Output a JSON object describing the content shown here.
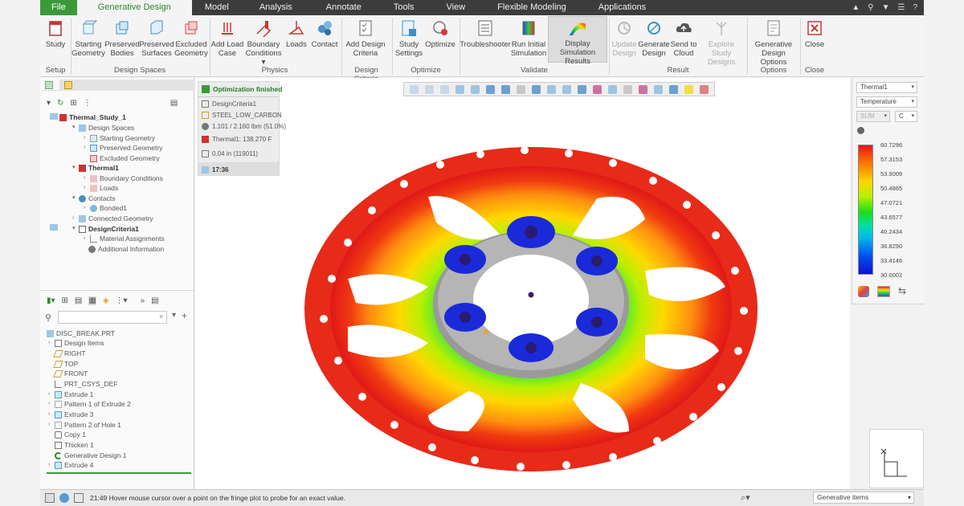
{
  "menu": {
    "tabs": [
      "File",
      "Generative Design",
      "Model",
      "Analysis",
      "Annotate",
      "Tools",
      "View",
      "Flexible Modeling",
      "Applications"
    ],
    "active": "Generative Design"
  },
  "ribbon": {
    "buttons": [
      {
        "line1": "Study",
        "line2": ""
      },
      {
        "line1": "Starting",
        "line2": "Geometry"
      },
      {
        "line1": "Preserved",
        "line2": "Bodies"
      },
      {
        "line1": "Preserved",
        "line2": "Surfaces"
      },
      {
        "line1": "Excluded",
        "line2": "Geometry"
      },
      {
        "line1": "Add Load",
        "line2": "Case"
      },
      {
        "line1": "Boundary",
        "line2": "Conditions ▾"
      },
      {
        "line1": "Loads",
        "line2": ""
      },
      {
        "line1": "Contact",
        "line2": ""
      },
      {
        "line1": "Add Design",
        "line2": "Criteria"
      },
      {
        "line1": "Study",
        "line2": "Settings"
      },
      {
        "line1": "Optimize",
        "line2": ""
      },
      {
        "line1": "Troubleshooter",
        "line2": ""
      },
      {
        "line1": "Run Initial",
        "line2": "Simulation"
      },
      {
        "line1": "Display",
        "line2": "Simulation Results"
      },
      {
        "line1": "Update",
        "line2": "Design"
      },
      {
        "line1": "Generate",
        "line2": "Design"
      },
      {
        "line1": "Send to",
        "line2": "Cloud"
      },
      {
        "line1": "Explore Study",
        "line2": "Designs"
      },
      {
        "line1": "Generative",
        "line2": "Design Options"
      },
      {
        "line1": "Close",
        "line2": ""
      }
    ],
    "groups": [
      "Setup",
      "Design Spaces",
      "Physics",
      "Design Criteria",
      "Optimize",
      "Validate",
      "Result",
      "Options",
      "Close"
    ]
  },
  "study_tree": {
    "items": [
      "Thermal_Study_1",
      "Design Spaces",
      "Starting Geometry",
      "Preserved Geometry",
      "Excluded Geometry",
      "Thermal1",
      "Boundary Conditions",
      "Loads",
      "Contacts",
      "Bonded1",
      "Connected Geometry",
      "DesignCriteria1",
      "Material Assignments",
      "Additional Information"
    ]
  },
  "model_tree": {
    "items": [
      "DISC_BREAK.PRT",
      "Design Items",
      "RIGHT",
      "TOP",
      "FRONT",
      "PRT_CSYS_DEF",
      "Extrude 1",
      "Pattern 1 of Extrude 2",
      "Extrude 3",
      "Pattern 2 of Hole 1",
      "Copy 1",
      "Thicken 1",
      "Generative Design 1",
      "Extrude 4"
    ]
  },
  "optimization": {
    "status": "Optimization finished",
    "criteria": "DesignCriteria1",
    "material": "STEEL_LOW_CARBON",
    "mass": "1.101 / 2.160 lbm (51.0%)",
    "thermal": "Thermal1: 138.270 F",
    "mesh": "0.04 in (119011)",
    "time": "17:36"
  },
  "legend": {
    "result": "Thermal1",
    "quantity": "Temperature",
    "component": "SUM",
    "unit": "C",
    "values": [
      "60.7296",
      "57.3153",
      "53.9009",
      "50.4865",
      "47.0721",
      "43.6577",
      "40.2434",
      "36.8290",
      "33.4146",
      "30.0002"
    ]
  },
  "status": {
    "message": "21:49 Hover mouse cursor over a point on the fringe plot to probe for an exact value.",
    "filter": "Generative items"
  },
  "colors": {
    "accent_green": "#3a9a3a",
    "menubar": "#3c3c3c"
  }
}
